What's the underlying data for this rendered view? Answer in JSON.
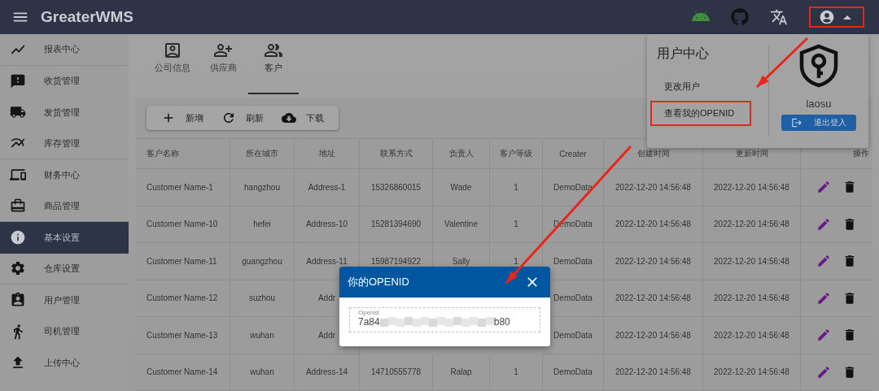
{
  "header": {
    "title": "GreaterWMS"
  },
  "user_button": {
    "expanded": true,
    "annotated": true
  },
  "sidebar": {
    "items": [
      {
        "label": "报表中心",
        "selected": false
      },
      {
        "label": "收货管理",
        "selected": false
      },
      {
        "label": "发货管理",
        "selected": false
      },
      {
        "label": "库存管理",
        "selected": false
      },
      {
        "label": "财务中心",
        "selected": false
      },
      {
        "label": "商品管理",
        "selected": false
      },
      {
        "label": "基本设置",
        "selected": true
      },
      {
        "label": "仓库设置",
        "selected": false
      },
      {
        "label": "用户管理",
        "selected": false
      },
      {
        "label": "司机管理",
        "selected": false
      },
      {
        "label": "上传中心",
        "selected": false
      }
    ]
  },
  "tabs": [
    {
      "label": "公司信息",
      "selected": false
    },
    {
      "label": "供应商",
      "selected": false
    },
    {
      "label": "客户",
      "selected": true
    }
  ],
  "toolbar": {
    "buttons": [
      "新增",
      "刷新",
      "下载"
    ]
  },
  "table": {
    "columns": [
      "客户名称",
      "所在城市",
      "地址",
      "联系方式",
      "负责人",
      "客户等级",
      "Creater",
      "创建时间",
      "更新时间",
      "操作"
    ],
    "rows": [
      {
        "cells": [
          "Customer Name-1",
          "hangzhou",
          "Address-1",
          "15326860015",
          "Wade",
          "1",
          "DemoData",
          "2022-12-20 14:56:48",
          "2022-12-20 14:56:48"
        ]
      },
      {
        "cells": [
          "Customer Name-10",
          "hefei",
          "Address-10",
          "15281394690",
          "Valentine",
          "1",
          "DemoData",
          "2022-12-20 14:56:48",
          "2022-12-20 14:56:48"
        ]
      },
      {
        "cells": [
          "Customer Name-11",
          "guangzhou",
          "Address-11",
          "15987194922",
          "Sally",
          "1",
          "DemoData",
          "2022-12-20 14:56:48",
          "2022-12-20 14:56:48"
        ]
      },
      {
        "cells": [
          "Customer Name-12",
          "suzhou",
          "Addr",
          null,
          null,
          null,
          "DemoData",
          "2022-12-20 14:56:48",
          "2022-12-20 14:56:48"
        ]
      },
      {
        "cells": [
          "Customer Name-13",
          "wuhan",
          "Addr",
          null,
          null,
          null,
          "DemoData",
          "2022-12-20 14:56:48",
          "2022-12-20 14:56:48"
        ]
      },
      {
        "cells": [
          "Customer Name-14",
          "wuhan",
          "Address-14",
          "14710555778",
          "Ralap",
          "1",
          "DemoData",
          "2022-12-20 14:56:48",
          "2022-12-20 14:56:48"
        ]
      }
    ]
  },
  "user_menu": {
    "title": "用户中心",
    "items": [
      {
        "label": "更改用户",
        "annotated": false
      },
      {
        "label": "查看我的OPENID",
        "annotated": true
      }
    ],
    "username": "laosu",
    "logout": "退出登入"
  },
  "dialog": {
    "title": "你的OPENID",
    "field": {
      "label": "Openid",
      "value_start": "7a84",
      "value_end": "b80"
    }
  }
}
